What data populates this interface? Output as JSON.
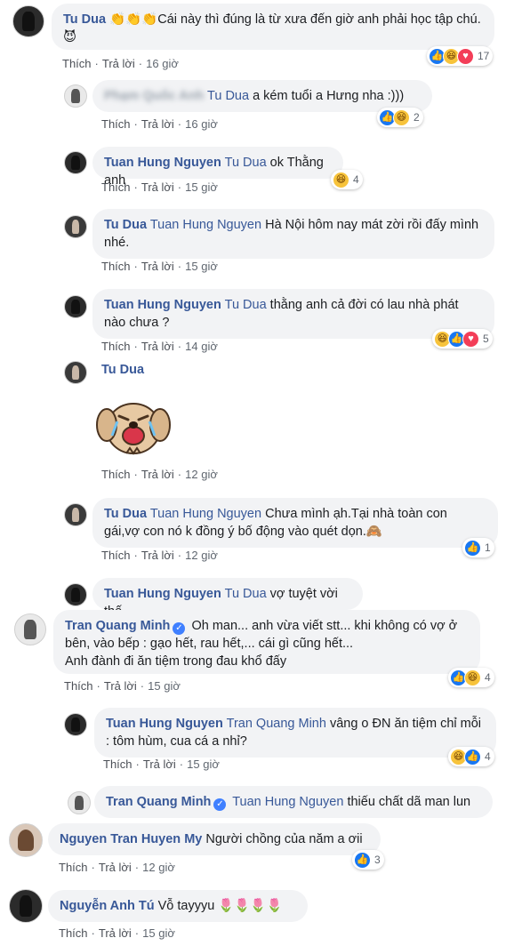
{
  "comments": [
    {
      "name": "Tu Dua",
      "text": " 👏👏👏Cái này thì đúng là từ xưa đến giờ anh phải học tập chú.😈",
      "time": "16 giờ",
      "reactions": "17"
    },
    {
      "name": "Phạm Quốc Anh",
      "tag": "Tu Dua",
      "text": " a kém tuổi a Hưng nha :)))",
      "time": "16 giờ",
      "reactions": "2"
    },
    {
      "name": "Tuan Hung Nguyen",
      "tag": "Tu Dua",
      "text": " ok Thằng anh",
      "time": "15 giờ",
      "reactions": "4"
    },
    {
      "name": "Tu Dua",
      "tag": "Tuan Hung Nguyen",
      "text": " Hà Nội hôm nay mát zời rồi đấy mình nhé.",
      "time": "15 giờ"
    },
    {
      "name": "Tuan Hung Nguyen",
      "tag": "Tu Dua",
      "text": " thằng anh cả đời có lau nhà phát nào chưa ?",
      "time": "14 giờ",
      "reactions": "5"
    },
    {
      "name": "Tu Dua",
      "time": "12 giờ"
    },
    {
      "name": "Tu Dua",
      "tag": "Tuan Hung Nguyen",
      "text": " Chưa mình ạh.Tại nhà toàn con gái,vợ con nó k đồng ý bố động vào quét dọn.🙈",
      "time": "12 giờ",
      "reactions": "1"
    },
    {
      "name": "Tuan Hung Nguyen",
      "tag": "Tu Dua",
      "text": " vợ tuyệt vời thế"
    },
    {
      "name": "Tran Quang Minh",
      "text": "Oh man... anh vừa viết stt... khi không có vợ ở bên, vào bếp : gạo hết, rau hết,... cái gì cũng hết...",
      "text2": "Anh đành đi ăn tiệm trong đau khổ đấy",
      "time": "15 giờ",
      "reactions": "4"
    },
    {
      "name": "Tuan Hung Nguyen",
      "tag": "Tran Quang Minh",
      "text": " vâng o ĐN ăn tiệm chỉ mỗi : tôm hùm, cua cá a nhỉ?",
      "time": "15 giờ",
      "reactions": "4"
    },
    {
      "name": "Tran Quang Minh",
      "tag": "Tuan Hung Nguyen",
      "text": " thiếu chất dã man lun"
    },
    {
      "name": "Nguyen Tran Huyen My",
      "text": " Người chồng của năm a ơii",
      "time": "12 giờ",
      "reactions": "3"
    },
    {
      "name": "Nguyễn Anh Tú",
      "text": " Vỗ tayyyu 🌷🌷🌷🌷",
      "time": "15 giờ"
    }
  ],
  "ui": {
    "like": "Thích",
    "reply": "Trả lời",
    "dot": "·"
  }
}
